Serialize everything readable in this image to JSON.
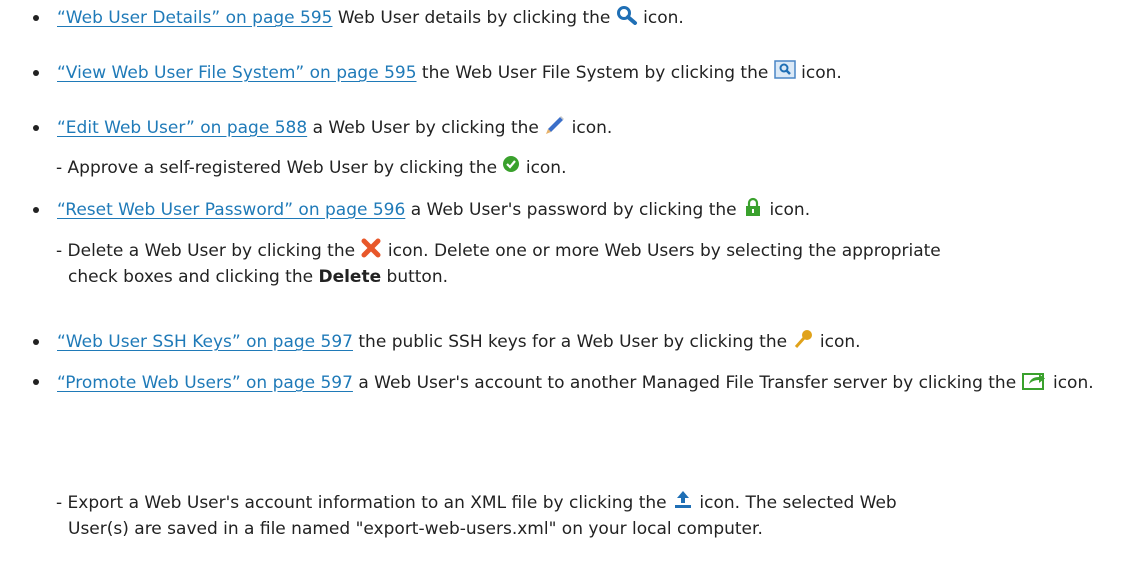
{
  "items": [
    {
      "link": "“Web User Details” on page 595",
      "before": " Web User details by clicking the ",
      "icon": "magnifier-icon",
      "after": " icon."
    },
    {
      "link": "“View Web User File System” on page 595",
      "before": " the Web User File System by clicking the ",
      "icon": "view-file-system-icon",
      "after": " icon."
    },
    {
      "link": "“Edit Web User” on page 588",
      "before": " a Web User by clicking the ",
      "icon": "pencil-icon",
      "after": " icon."
    },
    {
      "link": "“Reset Web User Password” on page 596",
      "before": " a Web User's password by clicking the ",
      "icon": "lock-icon",
      "after": " icon."
    },
    {
      "link": "“Web User SSH Keys” on page 597",
      "before": " the public SSH keys for a Web User by clicking the ",
      "icon": "key-icon",
      "after": " icon."
    },
    {
      "link": "“Promote Web Users” on page 597",
      "before": " a Web User's account to another Managed File Transfer server by clicking the ",
      "icon": "promote-icon",
      "after": " icon."
    }
  ],
  "subs": {
    "approve": {
      "before": "- Approve a self-registered Web User by clicking the ",
      "icon": "approve-check-icon",
      "after": " icon."
    },
    "delete": {
      "before": "- Delete a Web User by clicking the ",
      "icon": "delete-x-icon",
      "after_line1": " icon. Delete one or more Web Users by selecting the appropriate",
      "line2_before": "check boxes and clicking the ",
      "bold": "Delete",
      "line2_after": " button."
    },
    "export": {
      "before": "- Export a Web User's account information to an XML file by clicking the ",
      "icon": "export-upload-icon",
      "after_line1": " icon. The selected Web",
      "line2": "User(s) are saved in a file named \"export-web-users.xml\" on your local computer."
    }
  },
  "colors": {
    "link": "#1f7ab8",
    "text": "#222222",
    "lock_green": "#3aa12d",
    "delete_orange": "#e8572a",
    "key_gold": "#e0a21a",
    "search_blue": "#1f6fb5"
  }
}
